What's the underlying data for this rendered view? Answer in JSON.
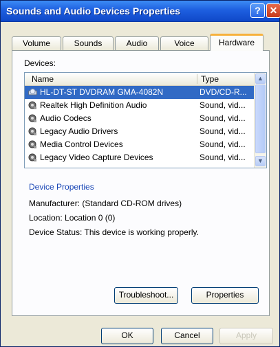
{
  "window": {
    "title": "Sounds and Audio Devices Properties",
    "help_glyph": "?",
    "close_glyph": "✕"
  },
  "tabs": [
    {
      "label": "Volume"
    },
    {
      "label": "Sounds"
    },
    {
      "label": "Audio"
    },
    {
      "label": "Voice"
    },
    {
      "label": "Hardware",
      "active": true
    }
  ],
  "devices": {
    "label": "Devices:",
    "columns": {
      "name": "Name",
      "type": "Type"
    },
    "rows": [
      {
        "name": "HL-DT-ST DVDRAM GMA-4082N",
        "type": "DVD/CD-R...",
        "selected": true,
        "icon": "cd-drive-icon"
      },
      {
        "name": "Realtek High Definition Audio",
        "type": "Sound, vid...",
        "icon": "sound-device-icon"
      },
      {
        "name": "Audio Codecs",
        "type": "Sound, vid...",
        "icon": "sound-device-icon"
      },
      {
        "name": "Legacy Audio Drivers",
        "type": "Sound, vid...",
        "icon": "sound-device-icon"
      },
      {
        "name": "Media Control Devices",
        "type": "Sound, vid...",
        "icon": "sound-device-icon"
      },
      {
        "name": "Legacy Video Capture Devices",
        "type": "Sound, vid...",
        "icon": "sound-device-icon"
      }
    ],
    "scroll_up": "▲",
    "scroll_down": "▼"
  },
  "device_properties": {
    "heading": "Device Properties",
    "manufacturer": "Manufacturer: (Standard CD-ROM drives)",
    "location": "Location: Location 0 (0)",
    "status": "Device Status: This device is working properly."
  },
  "buttons": {
    "troubleshoot": "Troubleshoot...",
    "properties": "Properties",
    "ok": "OK",
    "cancel": "Cancel",
    "apply": "Apply"
  },
  "colors": {
    "title_bar": "#1e5fe0",
    "selection": "#316ac5",
    "active_tab_accent": "#f7b13c",
    "link_blue": "#1a47b6"
  }
}
